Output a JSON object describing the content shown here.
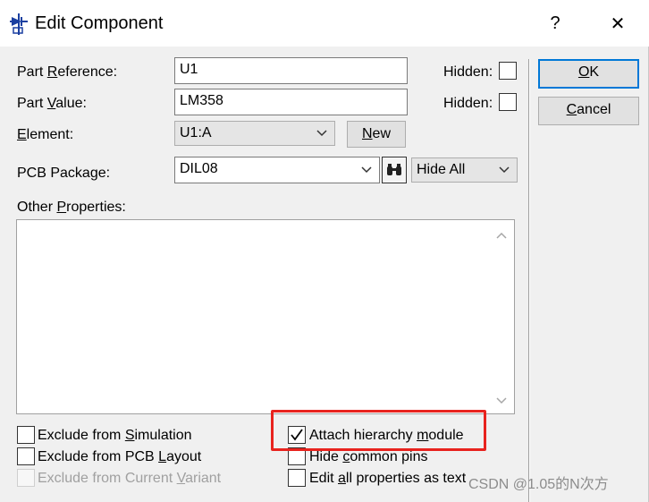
{
  "window": {
    "title": "Edit Component",
    "help_label": "?",
    "close_label": "✕"
  },
  "fields": {
    "part_reference": {
      "pre": "Part ",
      "key": "R",
      "post": "eference:",
      "value": "U1"
    },
    "part_value": {
      "pre": "Part ",
      "key": "V",
      "post": "alue:",
      "value": "LM358"
    },
    "element": {
      "pre": "",
      "key": "E",
      "post": "lement:",
      "value": "U1:A"
    },
    "pcb_package": {
      "label": "PCB Package:",
      "value": "DIL08",
      "visibility": "Hide All"
    },
    "hidden_label": "Hidden:"
  },
  "buttons": {
    "new": {
      "key": "N",
      "post": "ew"
    },
    "ok": {
      "key": "O",
      "post": "K"
    },
    "cancel": {
      "key": "C",
      "post": "ancel"
    }
  },
  "other_properties": {
    "pre": "Other ",
    "key": "P",
    "post": "roperties:"
  },
  "checkboxes": {
    "exclude_simulation": {
      "pre": "Exclude from ",
      "key": "S",
      "post": "imulation",
      "checked": false,
      "enabled": true
    },
    "exclude_pcb": {
      "pre": "Exclude from PCB ",
      "key": "L",
      "post": "ayout",
      "checked": false,
      "enabled": true
    },
    "exclude_variant": {
      "pre": "Exclude from Current ",
      "key": "V",
      "post": "ariant",
      "checked": false,
      "enabled": false
    },
    "attach_hierarchy": {
      "pre": "Attach hierarchy ",
      "key": "m",
      "post": "odule",
      "checked": true,
      "enabled": true
    },
    "hide_common_pins": {
      "pre": "Hide ",
      "key": "c",
      "post": "ommon pins",
      "checked": false,
      "enabled": true
    },
    "edit_all_text": {
      "pre": "Edit ",
      "key": "a",
      "post": "ll properties as text",
      "checked": false,
      "enabled": true
    }
  },
  "watermark": "CSDN @1.05的N次方",
  "colors": {
    "highlight": "#e8231e",
    "default_button_border": "#0078d7"
  }
}
